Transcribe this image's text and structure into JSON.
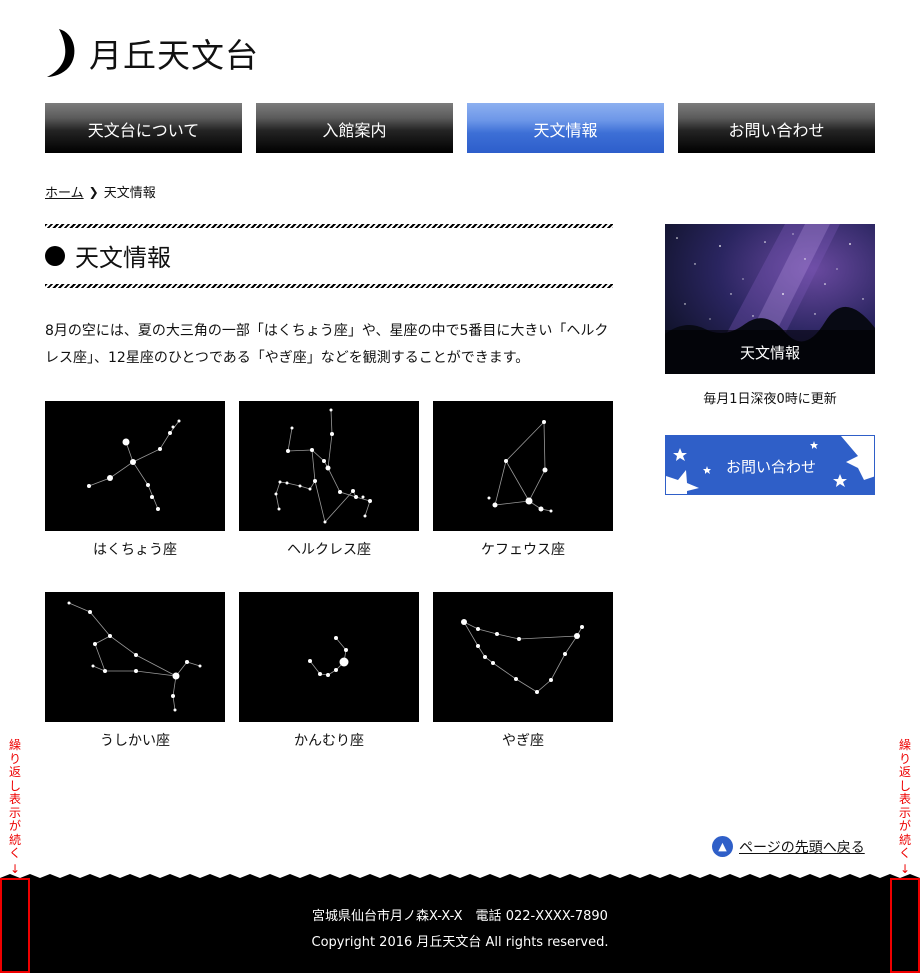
{
  "site": {
    "title": "月丘天文台"
  },
  "nav": {
    "items": [
      {
        "label": "天文台について"
      },
      {
        "label": "入館案内"
      },
      {
        "label": "天文情報"
      },
      {
        "label": "お問い合わせ"
      }
    ],
    "active_index": 2
  },
  "breadcrumb": {
    "home": "ホーム",
    "current": "天文情報"
  },
  "main": {
    "title": "天文情報",
    "intro": "8月の空には、夏の大三角の一部「はくちょう座」や、星座の中で5番目に大きい「ヘルクレス座」、12星座のひとつである「やぎ座」などを観測することができます。",
    "constellations": [
      {
        "name": "はくちょう座"
      },
      {
        "name": "ヘルクレス座"
      },
      {
        "name": "ケフェウス座"
      },
      {
        "name": "うしかい座"
      },
      {
        "name": "かんむり座"
      },
      {
        "name": "やぎ座"
      }
    ]
  },
  "sidebar": {
    "image_caption": "天文情報",
    "note": "毎月1日深夜0時に更新",
    "contact_label": "お問い合わせ"
  },
  "back_to_top": "ページの先頭へ戻る",
  "footer": {
    "address": "宮城県仙台市月ノ森X-X-X　電話 022-XXXX-7890",
    "copyright": "Copyright 2016 月丘天文台 All rights reserved."
  },
  "annotation": {
    "repeat_label": "繰り返し表示が続く"
  },
  "colors": {
    "accent": "#2f5fc8",
    "annotation": "#e00000",
    "footer_bg": "#000000"
  }
}
